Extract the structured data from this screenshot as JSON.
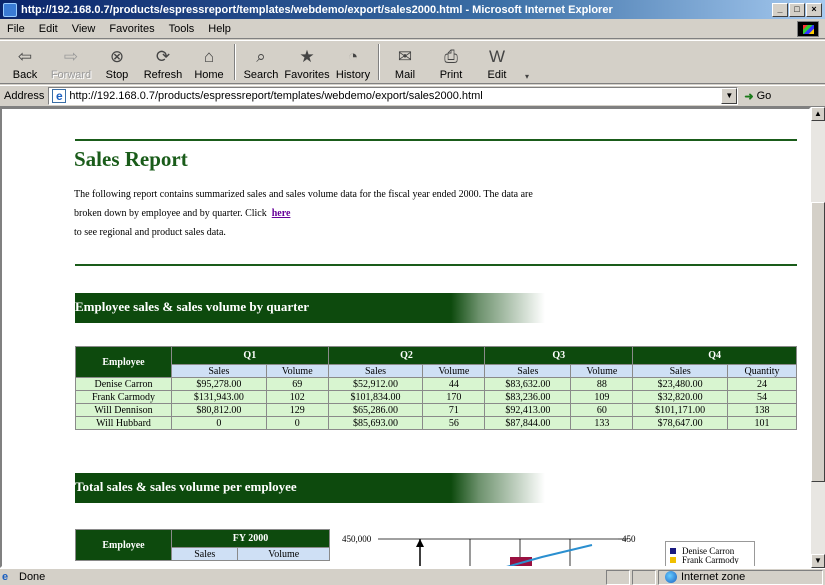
{
  "window": {
    "title": "http://192.168.0.7/products/espressreport/templates/webdemo/export/sales2000.html - Microsoft Internet Explorer",
    "minimize": "_",
    "maximize": "□",
    "close": "×"
  },
  "menu": {
    "file": "File",
    "edit": "Edit",
    "view": "View",
    "favorites": "Favorites",
    "tools": "Tools",
    "help": "Help"
  },
  "toolbar": {
    "back": "Back",
    "forward": "Forward",
    "stop": "Stop",
    "refresh": "Refresh",
    "home": "Home",
    "search": "Search",
    "favorites": "Favorites",
    "history": "History",
    "mail": "Mail",
    "print": "Print",
    "edit": "Edit"
  },
  "address": {
    "label": "Address",
    "url": "http://192.168.0.7/products/espressreport/templates/webdemo/export/sales2000.html",
    "go": "Go"
  },
  "report": {
    "title": "Sales Report",
    "intro_part1": "The following report contains summarized sales and sales volume data for the fiscal year ended 2000. The data are broken down by employee and by quarter. Click",
    "intro_link": "here",
    "intro_part2": "to see regional and product sales data.",
    "section1_title": "Employee sales & sales volume by quarter",
    "section2_title": "Total sales & sales volume per employee"
  },
  "quarter_table": {
    "employee_header": "Employee",
    "quarters": [
      "Q1",
      "Q2",
      "Q3",
      "Q4"
    ],
    "sub_headers": [
      [
        "Sales",
        "Volume"
      ],
      [
        "Sales",
        "Volume"
      ],
      [
        "Sales",
        "Volume"
      ],
      [
        "Sales",
        "Quantity"
      ]
    ],
    "rows": [
      {
        "employee": "Denise Carron",
        "values": [
          "$95,278.00",
          "69",
          "$52,912.00",
          "44",
          "$83,632.00",
          "88",
          "$23,480.00",
          "24"
        ]
      },
      {
        "employee": "Frank Carmody",
        "values": [
          "$131,943.00",
          "102",
          "$101,834.00",
          "170",
          "$83,236.00",
          "109",
          "$32,820.00",
          "54"
        ]
      },
      {
        "employee": "Will Dennison",
        "values": [
          "$80,812.00",
          "129",
          "$65,286.00",
          "71",
          "$92,413.00",
          "60",
          "$101,171.00",
          "138"
        ]
      },
      {
        "employee": "Will Hubbard",
        "values": [
          "0",
          "0",
          "$85,693.00",
          "56",
          "$87,844.00",
          "133",
          "$78,647.00",
          "101"
        ]
      }
    ]
  },
  "total_table": {
    "employee_header": "Employee",
    "period": "FY 2000",
    "sub_headers": [
      "Sales",
      "Volume"
    ]
  },
  "chart_data": {
    "type": "bar",
    "y_left_top_label": "450,000",
    "y_right_top_label": "450",
    "legend": [
      "Denise Carron",
      "Frank Carmody"
    ],
    "colors": {
      "denise": "#1a1a80",
      "frank": "#f0c000",
      "bar": "#9a1040",
      "line": "#2a8fd0"
    }
  },
  "status": {
    "text": "Done",
    "zone": "Internet zone"
  }
}
